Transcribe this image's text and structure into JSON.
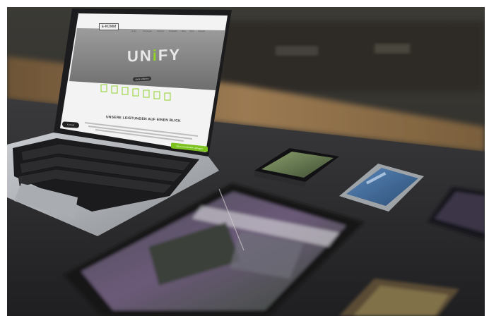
{
  "scene": {
    "subject": "devices-on-table",
    "colors": {
      "table": "#2f2f31",
      "background_wall": "#3a3228",
      "floor_glow": "#8a6a45",
      "laptop_body": "#b9bcc0",
      "keyboard": "#1b1b1d",
      "screen_bg": "#f2f2f2",
      "hero_bg": "#8e8e8e",
      "accent_green": "#7cc31f"
    }
  },
  "laptop_screen": {
    "logo_text": "E-KOMM",
    "nav": [
      "Unify",
      "Lösungen",
      "Service",
      "Produkte",
      "Blog",
      "Shop",
      "Kontakt"
    ],
    "hero_brand_start": "UN",
    "hero_brand_accent": "i",
    "hero_brand_end": "FY",
    "hero_button": "mehr erfahren",
    "section_title": "UNSERE LEISTUNGEN AUF EINEN BLICK",
    "left_pill": "Kontakt",
    "cta": "Jetzt unverbindlich anfragen"
  }
}
